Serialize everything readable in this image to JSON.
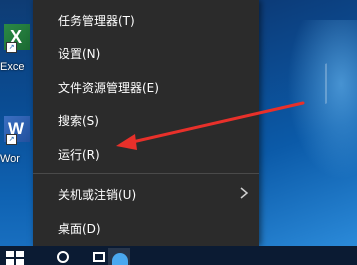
{
  "desktop": {
    "icons": [
      {
        "label": "Exce"
      },
      {
        "label": "Wor"
      }
    ]
  },
  "context_menu": {
    "items": [
      {
        "label": "任务管理器(T)"
      },
      {
        "label": "设置(N)"
      },
      {
        "label": "文件资源管理器(E)"
      },
      {
        "label": "搜索(S)"
      },
      {
        "label": "运行(R)"
      },
      {
        "label": "关机或注销(U)",
        "has_submenu": true
      },
      {
        "label": "桌面(D)"
      }
    ]
  },
  "annotation": {
    "color": "#e8302a",
    "target": "运行(R)"
  },
  "icons": {
    "submenu": "chevron-right-icon",
    "start": "windows-logo-icon",
    "search": "search-icon",
    "taskview": "task-view-icon",
    "browser": "edge-icon"
  }
}
